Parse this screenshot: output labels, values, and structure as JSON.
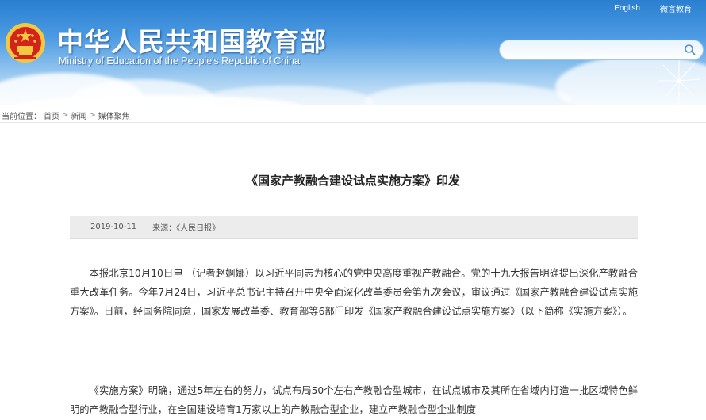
{
  "header": {
    "title": "中华人民共和国教育部",
    "subtitle": "Ministry of Education of the People's Republic of China",
    "links": [
      "English",
      "微言教育"
    ],
    "search": {
      "placeholder": "",
      "value": ""
    }
  },
  "breadcrumb": {
    "prefix": "当前位置：",
    "items": [
      "首页",
      "新闻",
      "媒体聚焦"
    ],
    "separator": ">"
  },
  "article": {
    "title": "《国家产教融合建设试点实施方案》印发",
    "date": "2019-10-11",
    "source": "来源：《人民日报》",
    "paragraphs": [
      "本报北京10月10日电 （记者赵婀娜）以习近平同志为核心的党中央高度重视产教融合。党的十九大报告明确提出深化产教融合重大改革任务。今年7月24日，习近平总书记主持召开中央全面深化改革委员会第九次会议，审议通过《国家产教融合建设试点实施方案》。日前，经国务院同意，国家发展改革委、教育部等6部门印发《国家产教融合建设试点实施方案》（以下简称《实施方案》）。",
      "《实施方案》明确，通过5年左右的努力，试点布局50个左右产教融合型城市，在试点城市及其所在省域内打造一批区域特色鲜明的产教融合型行业，在全国建设培育1万家以上的产教融合型企业，建立产教融合型企业制度"
    ]
  },
  "colors": {
    "header_blue": "#2a7fd0",
    "meta_bar": "#ececec",
    "emblem_red": "#d4231b",
    "emblem_gold": "#f5c842"
  },
  "icons": [
    "national-emblem-icon",
    "search-icon",
    "dandelion-decoration"
  ]
}
